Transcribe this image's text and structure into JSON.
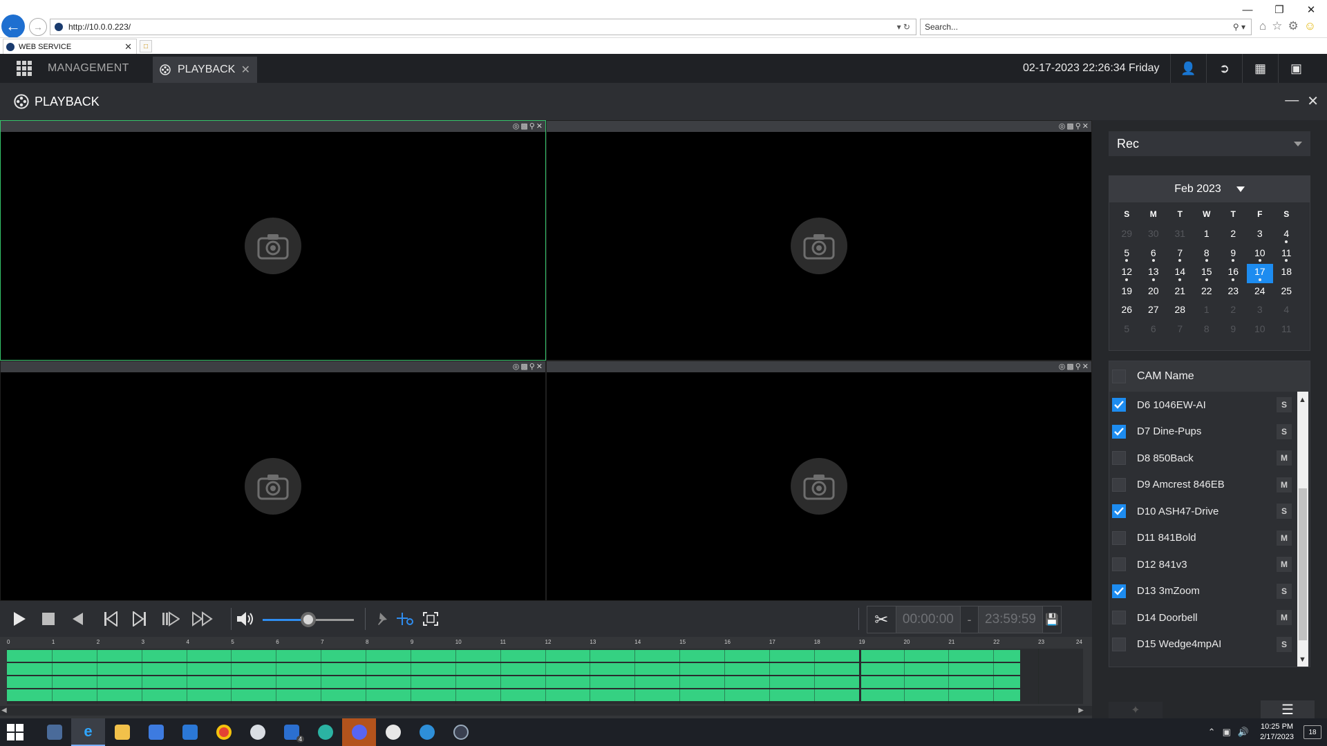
{
  "browser": {
    "url": "http://10.0.0.223/",
    "search_placeholder": "Search...",
    "tab_title": "WEB SERVICE"
  },
  "header": {
    "menu_management": "MANAGEMENT",
    "active_tab": "PLAYBACK",
    "datetime": "02-17-2023 22:26:34 Friday"
  },
  "playback": {
    "title": "PLAYBACK"
  },
  "controls": {
    "volume_fraction": 0.5,
    "clip_start": "00:00:00",
    "clip_dash": "-",
    "clip_end": "23:59:59"
  },
  "timeline": {
    "hours": [
      "0",
      "1",
      "2",
      "3",
      "4",
      "5",
      "6",
      "7",
      "8",
      "9",
      "10",
      "11",
      "12",
      "13",
      "14",
      "15",
      "16",
      "17",
      "18",
      "19",
      "20",
      "21",
      "22",
      "23",
      "24"
    ],
    "tracks": [
      {
        "segments": [
          [
            0,
            19
          ],
          [
            19.05,
            22.6
          ]
        ]
      },
      {
        "segments": [
          [
            0,
            19
          ],
          [
            19.05,
            22.6
          ]
        ]
      },
      {
        "segments": [
          [
            0,
            19
          ],
          [
            19.05,
            22.6
          ]
        ]
      },
      {
        "segments": [
          [
            0,
            19
          ],
          [
            19.05,
            22.6
          ]
        ]
      }
    ]
  },
  "right_panel": {
    "stream_type": "Rec",
    "calendar": {
      "month_label": "Feb 2023",
      "weekdays": [
        "S",
        "M",
        "T",
        "W",
        "T",
        "F",
        "S"
      ],
      "days": [
        {
          "d": "29",
          "other": true
        },
        {
          "d": "30",
          "other": true
        },
        {
          "d": "31",
          "other": true
        },
        {
          "d": "1"
        },
        {
          "d": "2"
        },
        {
          "d": "3"
        },
        {
          "d": "4",
          "rec": true
        },
        {
          "d": "5",
          "rec": true
        },
        {
          "d": "6",
          "rec": true
        },
        {
          "d": "7",
          "rec": true
        },
        {
          "d": "8",
          "rec": true
        },
        {
          "d": "9",
          "rec": true
        },
        {
          "d": "10",
          "rec": true
        },
        {
          "d": "11",
          "rec": true
        },
        {
          "d": "12",
          "rec": true
        },
        {
          "d": "13",
          "rec": true
        },
        {
          "d": "14",
          "rec": true
        },
        {
          "d": "15",
          "rec": true
        },
        {
          "d": "16",
          "rec": true
        },
        {
          "d": "17",
          "rec": true,
          "selected": true
        },
        {
          "d": "18"
        },
        {
          "d": "19"
        },
        {
          "d": "20"
        },
        {
          "d": "21"
        },
        {
          "d": "22"
        },
        {
          "d": "23"
        },
        {
          "d": "24"
        },
        {
          "d": "25"
        },
        {
          "d": "26"
        },
        {
          "d": "27"
        },
        {
          "d": "28"
        },
        {
          "d": "1",
          "other": true
        },
        {
          "d": "2",
          "other": true
        },
        {
          "d": "3",
          "other": true
        },
        {
          "d": "4",
          "other": true
        },
        {
          "d": "5",
          "other": true
        },
        {
          "d": "6",
          "other": true
        },
        {
          "d": "7",
          "other": true
        },
        {
          "d": "8",
          "other": true
        },
        {
          "d": "9",
          "other": true
        },
        {
          "d": "10",
          "other": true
        },
        {
          "d": "11",
          "other": true
        }
      ]
    },
    "cam_list_header": "CAM Name",
    "cameras": [
      {
        "name": "D6 1046EW-AI",
        "checked": true,
        "stream": "S"
      },
      {
        "name": "D7 Dine-Pups",
        "checked": true,
        "stream": "S"
      },
      {
        "name": "D8 850Back",
        "checked": false,
        "stream": "M"
      },
      {
        "name": "D9 Amcrest 846EB",
        "checked": false,
        "stream": "M"
      },
      {
        "name": "D10 ASH47-Drive",
        "checked": true,
        "stream": "S"
      },
      {
        "name": "D11 841Bold",
        "checked": false,
        "stream": "M"
      },
      {
        "name": "D12 841v3",
        "checked": false,
        "stream": "M"
      },
      {
        "name": "D13 3mZoom",
        "checked": true,
        "stream": "S"
      },
      {
        "name": "D14 Doorbell",
        "checked": false,
        "stream": "M"
      },
      {
        "name": "D15 Wedge4mpAI",
        "checked": false,
        "stream": "S"
      }
    ]
  },
  "taskbar": {
    "clock_time": "10:25 PM",
    "clock_date": "2/17/2023",
    "notifications": "18",
    "mail_count": "4"
  },
  "colors": {
    "accent_blue": "#1d8cf0",
    "record_green": "#35d182",
    "active_pane_border": "#35c66b"
  }
}
